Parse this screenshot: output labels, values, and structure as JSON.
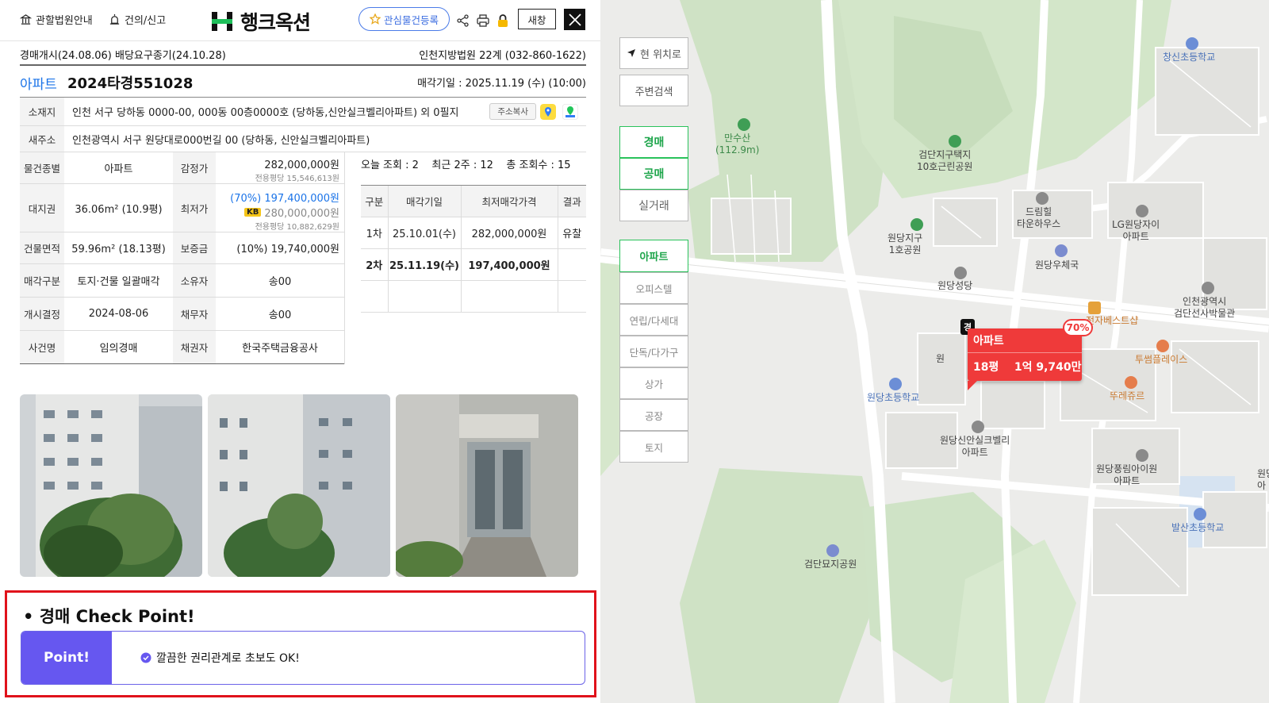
{
  "header": {
    "court_guide": "관할법원안내",
    "suggest": "건의/신고",
    "brand": "행크옥션",
    "favorite": "관심물건등록",
    "new_window": "새창"
  },
  "summary": {
    "start_info": "경매개시(24.08.06)  배당요구종기(24.10.28)",
    "court": "인천지방법원 22계 (032-860-1622)",
    "category": "아파트",
    "case_no": "2024타경551028",
    "sale_date": "매각기일 : 2025.11.19 (수) (10:00)"
  },
  "address": {
    "label": "소재지",
    "value": "인천 서구 당하동 0000-00, 000동 00층0000호 (당하동,신안실크벨리아파트) 외 0필지",
    "copy": "주소복사",
    "new_label": "새주소",
    "new_value": "인천광역시 서구 원당대로000번길 00 (당하동, 신안실크벨리아파트)"
  },
  "details": {
    "type_label": "물건종별",
    "type": "아파트",
    "appraisal_label": "감정가",
    "appraisal": "282,000,000원",
    "appraisal_sub": "전용평당 15,546,613원",
    "land_label": "대지권",
    "land": "36.06m² (10.9평)",
    "min_label": "최저가",
    "min_pct": "(70%) 197,400,000원",
    "kb_badge": "KB",
    "kb_price": "280,000,000원",
    "min_sub": "전용평당 10,882,629원",
    "area_label": "건물면적",
    "area": "59.96m² (18.13평)",
    "deposit_label": "보증금",
    "deposit": "(10%) 19,740,000원",
    "sale_kind_label": "매각구분",
    "sale_kind": "토지·건물 일괄매각",
    "owner_label": "소유자",
    "owner": "송00",
    "decision_label": "개시결정",
    "decision": "2024-08-06",
    "debtor_label": "채무자",
    "debtor": "송00",
    "case_name_label": "사건명",
    "case_name": "임의경매",
    "creditor_label": "채권자",
    "creditor": "한국주택금융공사"
  },
  "views": {
    "text": "오늘 조회 : 2    최근 2주 : 12    총 조회수 : 15"
  },
  "history": {
    "headers": [
      "구분",
      "매각기일",
      "최저매각가격",
      "결과"
    ],
    "rows": [
      [
        "1차",
        "25.10.01(수)",
        "282,000,000원",
        "유찰"
      ],
      [
        "2차",
        "25.11.19(수)",
        "197,400,000원",
        ""
      ]
    ]
  },
  "checkpoint": {
    "title": "• 경매 Check Point!",
    "badge": "Point!",
    "text": "깔끔한 권리관계로 초보도 OK!"
  },
  "map": {
    "controls": {
      "current": "현 위치로",
      "nearby": "주변검색",
      "auction": "경매",
      "public": "공매",
      "real": "실거래",
      "types": [
        "아파트",
        "오피스텔",
        "연립/다세대",
        "단독/다가구",
        "상가",
        "공장",
        "토지"
      ]
    },
    "labels": {
      "mansusan": "만수산\n(112.9m)",
      "park10": "검단지구택지\n10호근린공원",
      "park1": "원당지구\n1호공원",
      "dreamhill": "드림힐\n타운하우스",
      "lg": "LG원당자이\n아파트",
      "post": "원당우체국",
      "church": "원당성당",
      "changsin": "창신초등학교",
      "hangongsa": "인천광역시\n검단선사박물관",
      "electro": "전자베스트샵",
      "twosome": "투썸플레이스",
      "tous": "뚜레쥬르",
      "wondang_school": "원당초등학교",
      "wondang_apt": "원당신안실크벨리\n아파트",
      "pungrim": "원당풍림아이원\n아파트",
      "balsan": "발산초등학교",
      "cemetery": "검단묘지공원",
      "won": "원",
      "wondang_edge": "원당\n아"
    },
    "marker": {
      "badge": "경",
      "type": "아파트",
      "info": "18평    1억 9,740만",
      "pct": "70%"
    }
  },
  "colors": {
    "accent_blue": "#1a73e8",
    "marker_red": "#ef3a3a",
    "point_purple": "#6657f0",
    "check_border": "#e0121b",
    "map_green": "#2ac25b"
  }
}
